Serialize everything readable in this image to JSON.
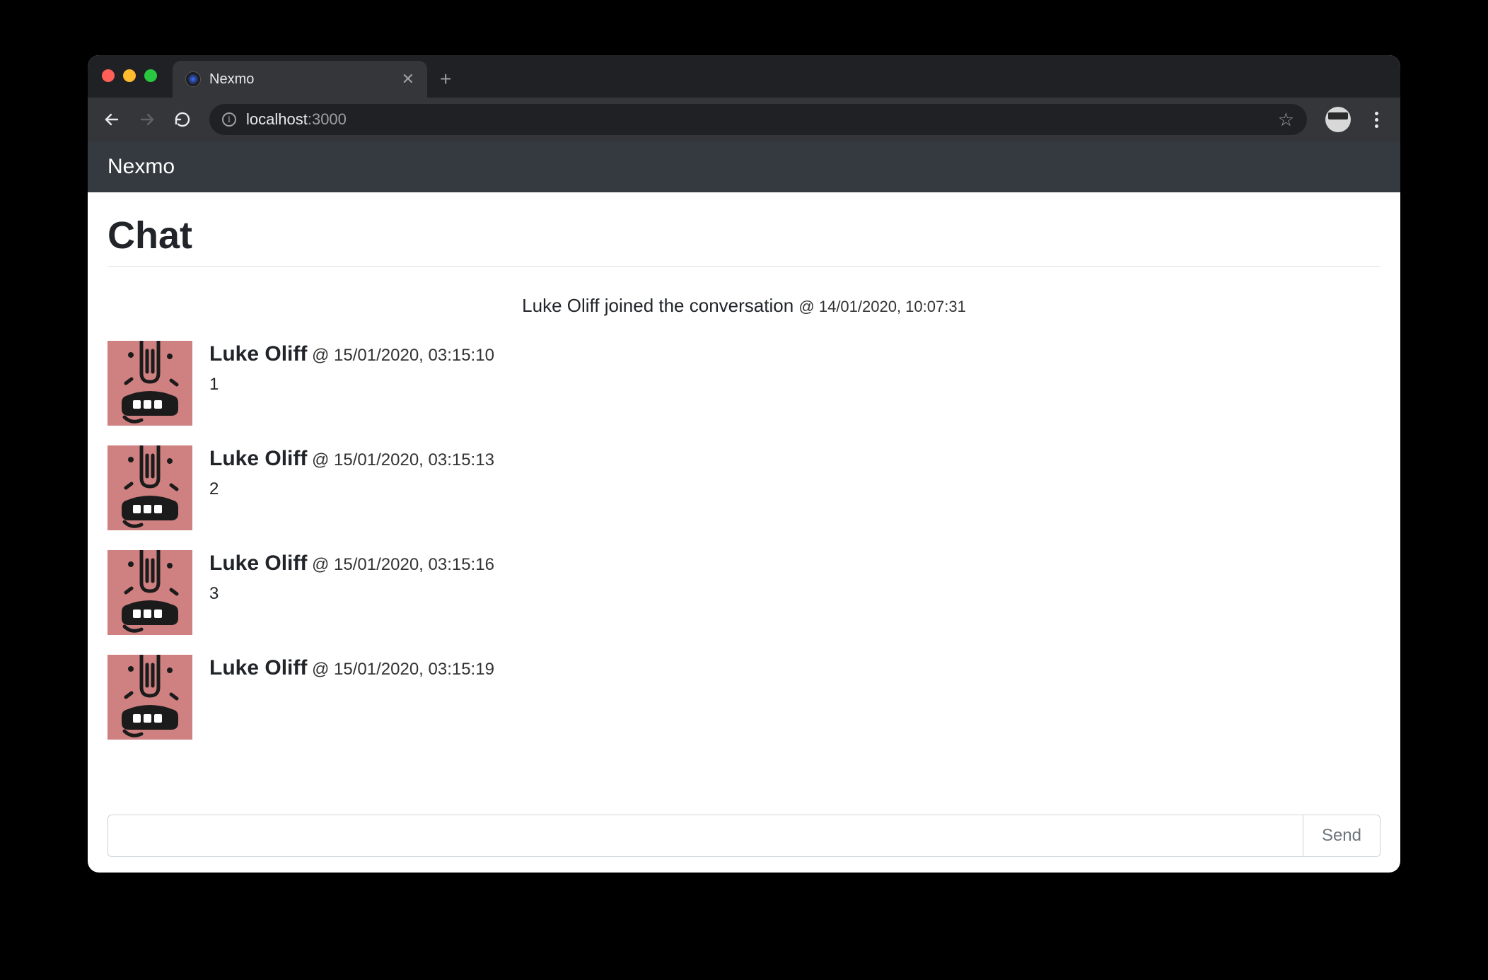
{
  "browser": {
    "tab_title": "Nexmo",
    "url_host": "localhost",
    "url_port": ":3000"
  },
  "app": {
    "brand": "Nexmo",
    "page_title": "Chat"
  },
  "join_event": {
    "user": "Luke Oliff",
    "action": " joined the conversation ",
    "at_symbol": "@ ",
    "timestamp": "14/01/2020, 10:07:31"
  },
  "messages": [
    {
      "author": "Luke Oliff",
      "at": " @ ",
      "timestamp": "15/01/2020, 03:15:10",
      "text": "1"
    },
    {
      "author": "Luke Oliff",
      "at": " @ ",
      "timestamp": "15/01/2020, 03:15:13",
      "text": "2"
    },
    {
      "author": "Luke Oliff",
      "at": " @ ",
      "timestamp": "15/01/2020, 03:15:16",
      "text": "3"
    },
    {
      "author": "Luke Oliff",
      "at": " @ ",
      "timestamp": "15/01/2020, 03:15:19",
      "text": ""
    }
  ],
  "composer": {
    "value": "",
    "send_label": "Send"
  }
}
